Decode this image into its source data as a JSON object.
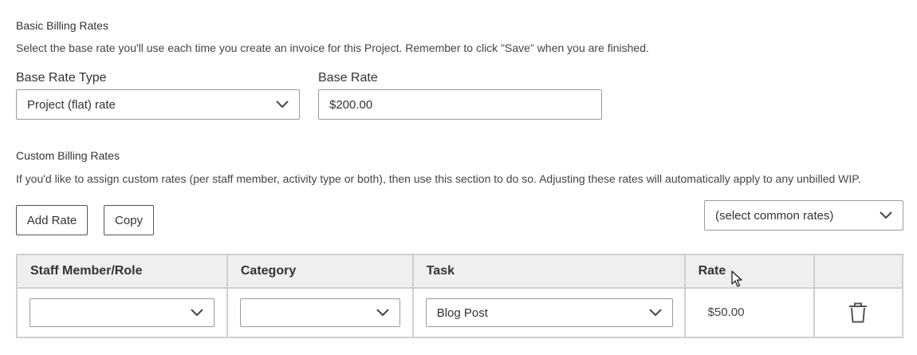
{
  "basic": {
    "title": "Basic Billing Rates",
    "description": "Select the base rate you'll use each time you create an invoice for this Project. Remember to click \"Save\" when you are finished.",
    "base_rate_type_label": "Base Rate Type",
    "base_rate_type_value": "Project (flat) rate",
    "base_rate_label": "Base Rate",
    "base_rate_value": "$200.00"
  },
  "custom": {
    "title": "Custom Billing Rates",
    "description": "If you'd like to assign custom rates (per staff member, activity type or both), then use this section to do so. Adjusting these rates will automatically apply to any unbilled WIP.",
    "add_rate_label": "Add Rate",
    "copy_label": "Copy",
    "common_rates_value": "(select common rates)"
  },
  "table": {
    "headers": [
      "Staff Member/Role",
      "Category",
      "Task",
      "Rate",
      ""
    ],
    "rows": [
      {
        "staff": "",
        "category": "",
        "task": "Blog Post",
        "rate": "$50.00"
      }
    ]
  },
  "icons": {
    "chevron": "chevron-down-icon",
    "delete": "trash-icon",
    "cursor": "mouse-pointer-icon"
  }
}
